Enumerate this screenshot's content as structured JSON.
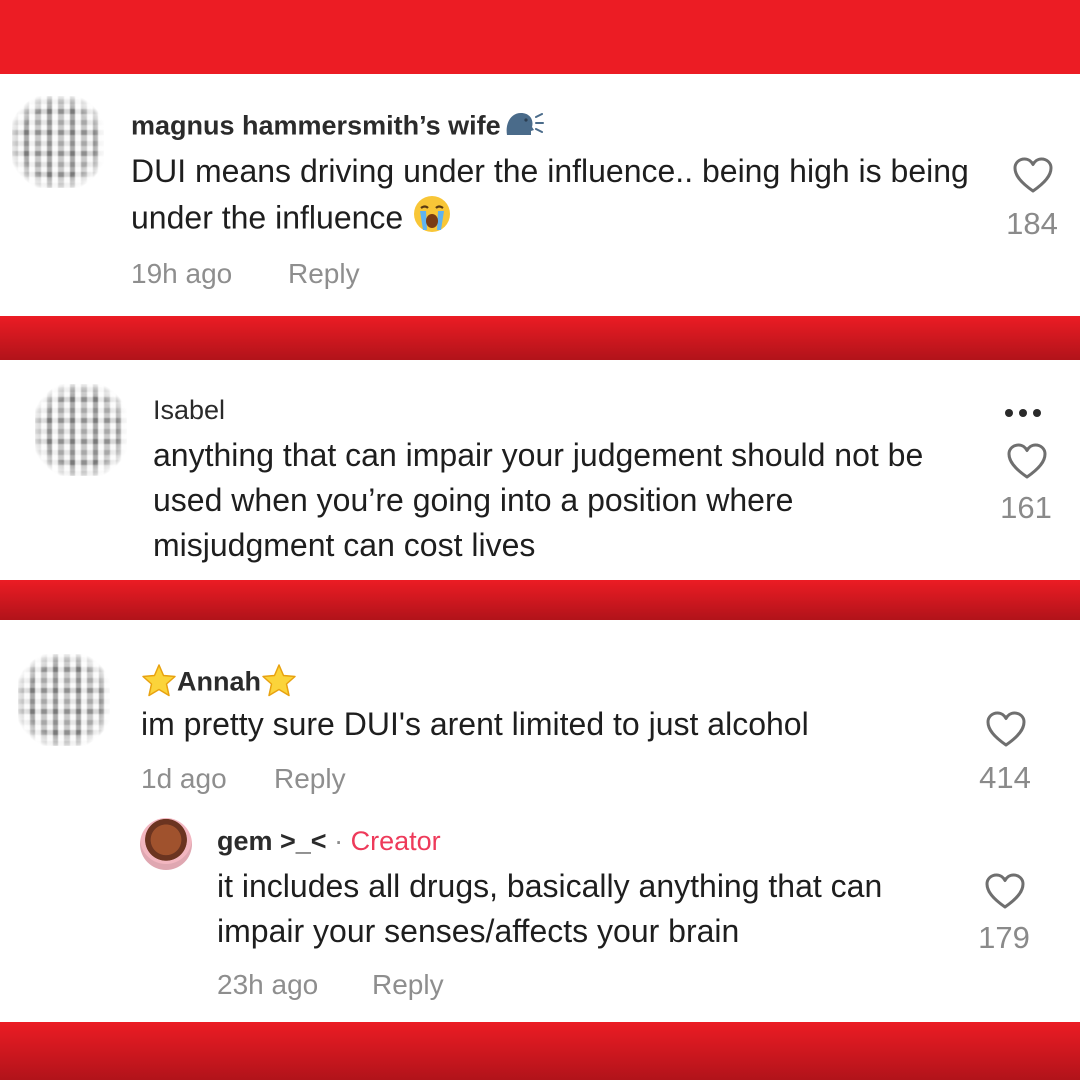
{
  "colors": {
    "background_red": "#ec1c24",
    "card": "#ffffff",
    "creator": "#ee3a5a",
    "muted": "#8e8e8e"
  },
  "comments": [
    {
      "username": "magnus hammersmith’s wife",
      "username_suffix_icon": "speaking-head-icon",
      "text": "DUI means driving under the influence.. being high is being under the influence",
      "text_suffix_icon": "loudly-crying-face-icon",
      "time": "19h ago",
      "reply_label": "Reply",
      "likes": "184"
    },
    {
      "username": "Isabel",
      "text": "anything that can impair your judgement should not be used when you’re going into a position where misjudgment can cost lives",
      "likes": "161",
      "more_icon": "more-options-icon"
    },
    {
      "username": "Annah",
      "username_icons": [
        "star-icon",
        "star-icon"
      ],
      "text": "im pretty sure DUI's arent limited to just alcohol",
      "time": "1d ago",
      "reply_label": "Reply",
      "likes": "414",
      "replies": [
        {
          "username": "gem >_<",
          "separator": " · ",
          "badge": "Creator",
          "text": "it includes all drugs, basically anything that can impair your senses/affects your brain",
          "time": "23h ago",
          "reply_label": "Reply",
          "likes": "179"
        }
      ]
    }
  ]
}
